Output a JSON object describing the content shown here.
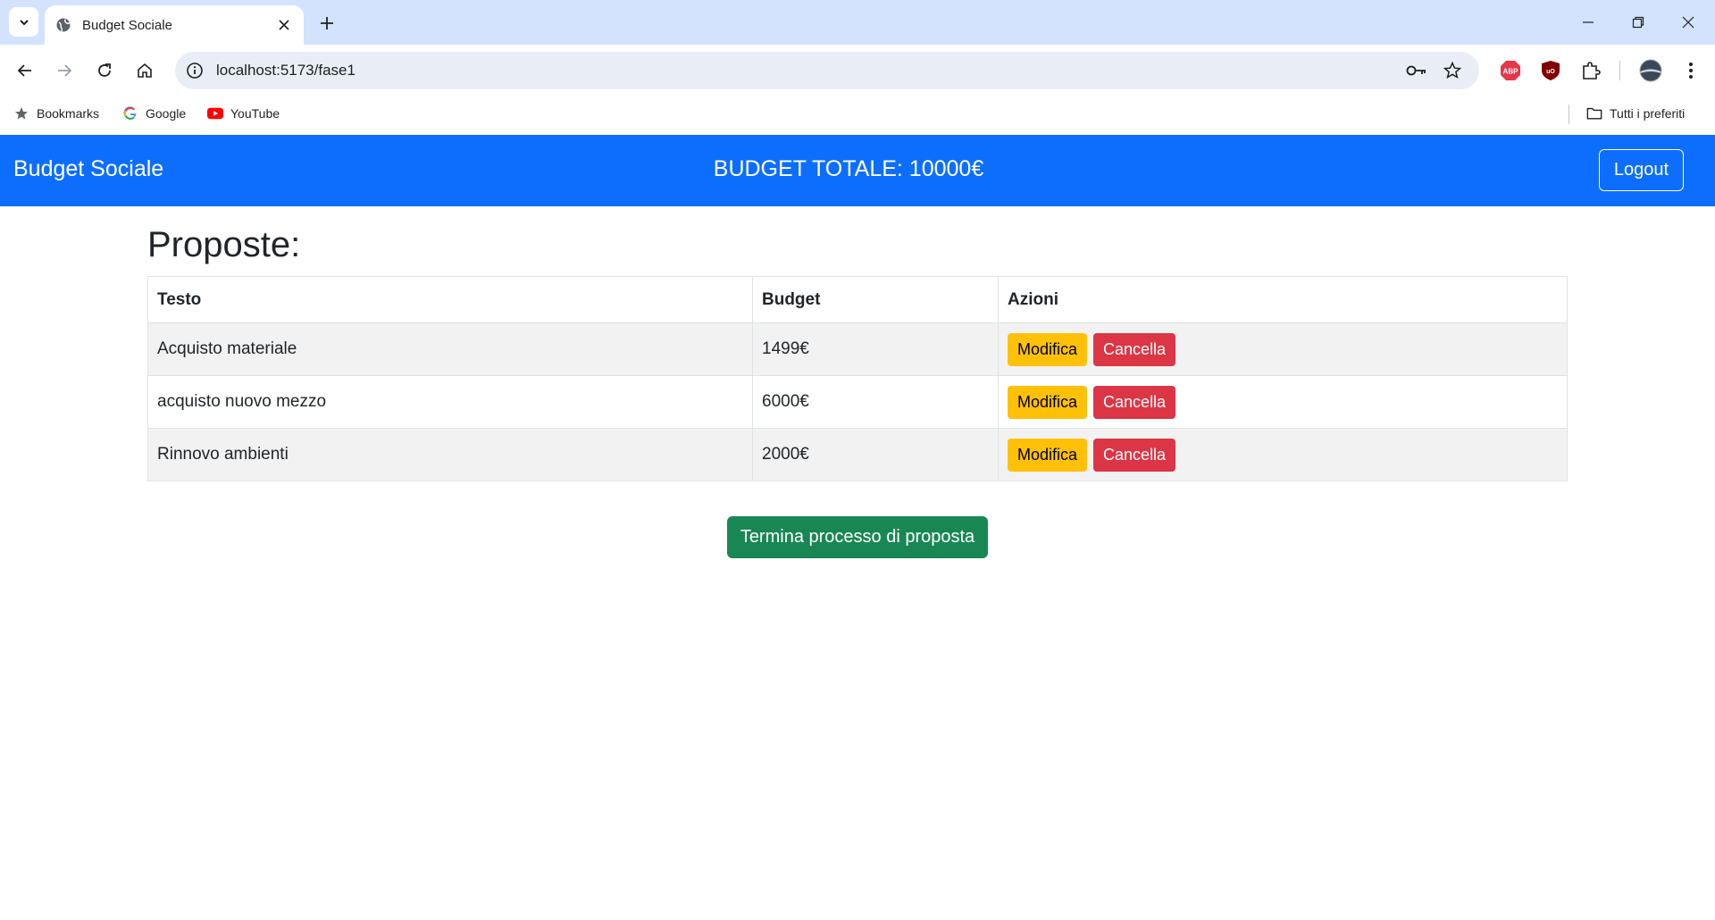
{
  "browser": {
    "tab_title": "Budget Sociale",
    "url": "localhost:5173/fase1",
    "bookmarks": [
      {
        "label": "Bookmarks",
        "icon": "star-icon"
      },
      {
        "label": "Google",
        "icon": "google-icon"
      },
      {
        "label": "YouTube",
        "icon": "youtube-icon"
      }
    ],
    "all_bookmarks_label": "Tutti i preferiti",
    "extensions": [
      "abp-icon",
      "ublock-icon",
      "puzzle-icon"
    ]
  },
  "navbar": {
    "brand": "Budget Sociale",
    "budget_total": "BUDGET TOTALE: 10000€",
    "logout_label": "Logout",
    "color": "#0d6efd"
  },
  "main": {
    "heading": "Proposte:",
    "table": {
      "headers": [
        "Testo",
        "Budget",
        "Azioni"
      ],
      "rows": [
        {
          "testo": "Acquisto materiale",
          "budget": "1499€",
          "edit": "Modifica",
          "delete": "Cancella"
        },
        {
          "testo": "acquisto nuovo mezzo",
          "budget": "6000€",
          "edit": "Modifica",
          "delete": "Cancella"
        },
        {
          "testo": "Rinnovo ambienti",
          "budget": "2000€",
          "edit": "Modifica",
          "delete": "Cancella"
        }
      ]
    },
    "finish_label": "Termina processo di proposta"
  },
  "colors": {
    "edit_button": "#ffc107",
    "delete_button": "#dc3545",
    "finish_button": "#198754"
  }
}
